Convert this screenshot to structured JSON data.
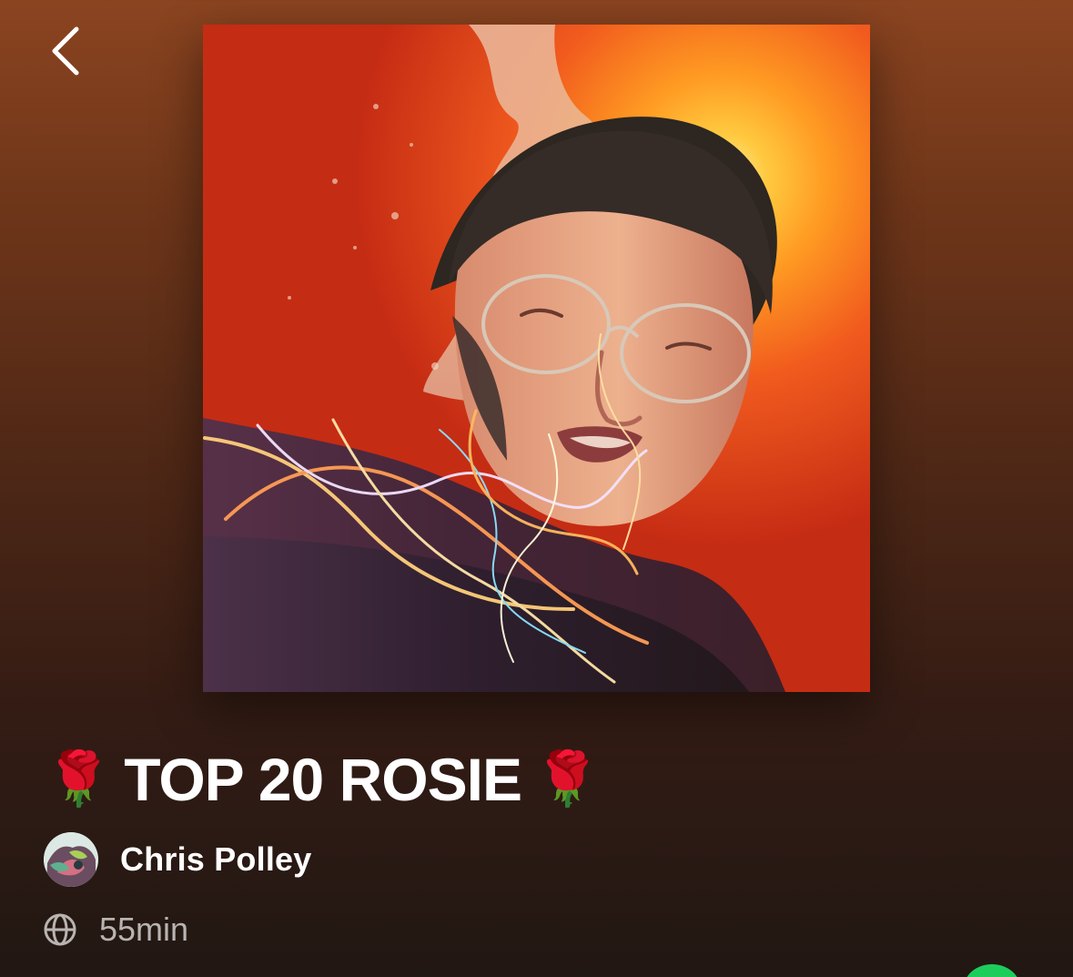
{
  "header": {
    "back_icon": "chevron-left-icon"
  },
  "playlist": {
    "cover_art": "playlist-cover-art",
    "title": "TOP 20 ROSIE",
    "title_prefix_emoji": "🌹",
    "title_suffix_emoji": "🌹",
    "owner_name": "Chris Polley",
    "owner_avatar": "user-avatar",
    "visibility_icon": "globe-icon",
    "duration": "55min"
  },
  "colors": {
    "background_top": "#8b4420",
    "background_bottom": "#211713",
    "accent_green": "#1ed760",
    "meta_text": "#b8b4b2"
  }
}
